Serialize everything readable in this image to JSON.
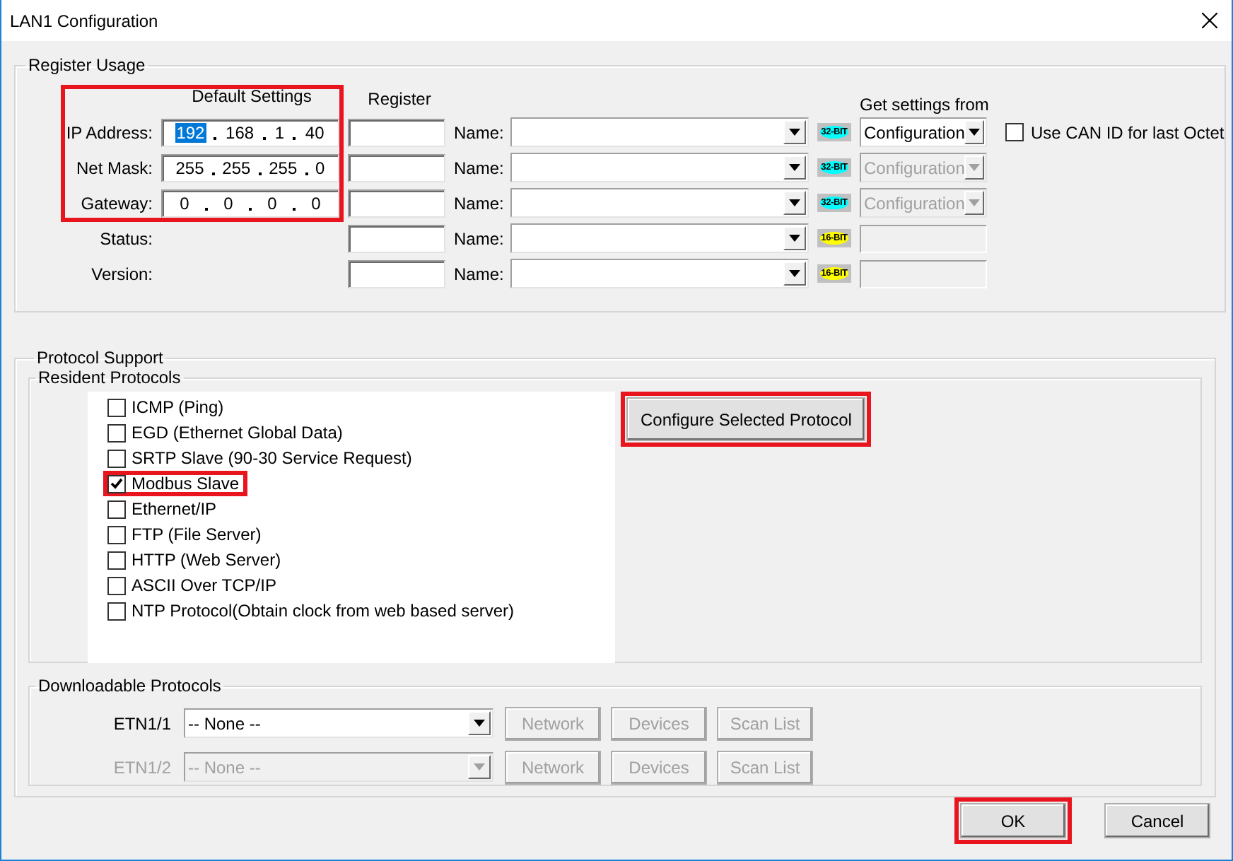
{
  "window": {
    "title": "LAN1 Configuration"
  },
  "register_usage": {
    "title": "Register Usage",
    "default_settings_header": "Default Settings",
    "register_header": "Register",
    "source_header": "Get settings from",
    "default_settings_highlighted": true,
    "rows": [
      {
        "kind": "ip",
        "label": "IP Address:",
        "octets": [
          {
            "value": "192",
            "selected": true
          },
          {
            "value": "168",
            "selected": false
          },
          {
            "value": "1",
            "selected": false
          },
          {
            "value": "40",
            "selected": false
          }
        ],
        "name_label": "Name:",
        "badge": "32-BIT",
        "color": "#00ffff",
        "source": "Configuration",
        "source_disabled": false
      },
      {
        "kind": "ip",
        "label": "Net Mask:",
        "octets": [
          {
            "value": "255",
            "selected": false
          },
          {
            "value": "255",
            "selected": false
          },
          {
            "value": "255",
            "selected": false
          },
          {
            "value": "0",
            "selected": false
          }
        ],
        "name_label": "Name:",
        "badge": "32-BIT",
        "color": "#00ffff",
        "source": "Configuration",
        "source_disabled": true
      },
      {
        "kind": "ip",
        "label": "Gateway:",
        "octets": [
          {
            "value": "0",
            "selected": false
          },
          {
            "value": "0",
            "selected": false
          },
          {
            "value": "0",
            "selected": false
          },
          {
            "value": "0",
            "selected": false
          }
        ],
        "name_label": "Name:",
        "badge": "32-BIT",
        "color": "#00ffff",
        "source": "Configuration",
        "source_disabled": true
      },
      {
        "kind": "plain",
        "label": "Status:",
        "name_label": "Name:",
        "badge": "16-BIT",
        "color": "#ffff00"
      },
      {
        "kind": "plain",
        "label": "Version:",
        "name_label": "Name:",
        "badge": "16-BIT",
        "color": "#ffff00"
      }
    ],
    "use_can_id": {
      "label": "Use CAN ID for last Octet",
      "checked": false
    }
  },
  "protocol_support": {
    "title": "Protocol Support",
    "resident": {
      "title": "Resident Protocols",
      "items": [
        {
          "label": "ICMP (Ping)",
          "checked": false,
          "highlighted": false
        },
        {
          "label": "EGD (Ethernet Global Data)",
          "checked": false,
          "highlighted": false
        },
        {
          "label": "SRTP Slave (90-30 Service Request)",
          "checked": false,
          "highlighted": false
        },
        {
          "label": "Modbus Slave",
          "checked": true,
          "highlighted": true
        },
        {
          "label": "Ethernet/IP",
          "checked": false,
          "highlighted": false
        },
        {
          "label": "FTP (File Server)",
          "checked": false,
          "highlighted": false
        },
        {
          "label": "HTTP (Web Server)",
          "checked": false,
          "highlighted": false
        },
        {
          "label": "ASCII Over TCP/IP",
          "checked": false,
          "highlighted": false
        },
        {
          "label": "NTP Protocol(Obtain clock from web based server)",
          "checked": false,
          "highlighted": false
        }
      ],
      "configure_button": {
        "label": "Configure Selected Protocol",
        "highlighted": true
      }
    },
    "downloadable": {
      "title": "Downloadable Protocols",
      "rows": [
        {
          "label": "ETN1/1",
          "value": "-- None --",
          "disabled": false,
          "buttons": [
            {
              "label": "Network",
              "disabled": true
            },
            {
              "label": "Devices",
              "disabled": true
            },
            {
              "label": "Scan List",
              "disabled": true
            }
          ]
        },
        {
          "label": "ETN1/2",
          "value": "-- None --",
          "disabled": true,
          "buttons": [
            {
              "label": "Network",
              "disabled": true
            },
            {
              "label": "Devices",
              "disabled": true
            },
            {
              "label": "Scan List",
              "disabled": true
            }
          ]
        }
      ]
    }
  },
  "footer": {
    "buttons": [
      {
        "label": "OK",
        "highlighted": true
      },
      {
        "label": "Cancel",
        "highlighted": false
      }
    ]
  }
}
